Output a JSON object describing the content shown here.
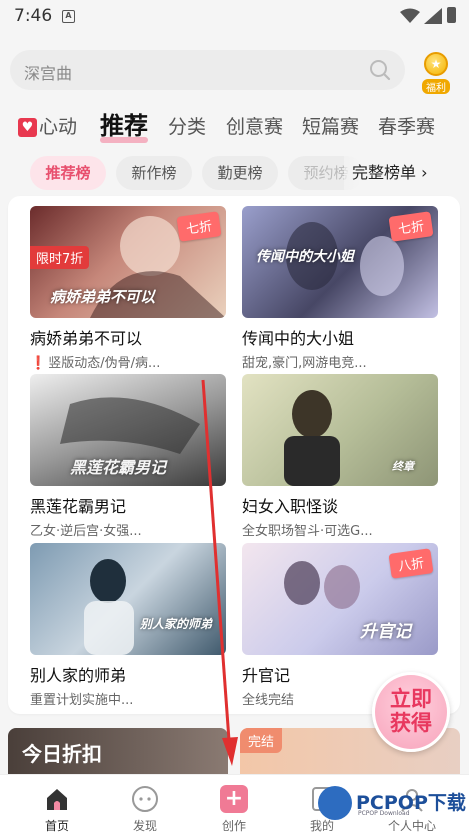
{
  "status_bar": {
    "time": "7:46",
    "notification_label": "A"
  },
  "search": {
    "placeholder": "深宫曲"
  },
  "welfare": {
    "label": "福利"
  },
  "category_tabs": [
    {
      "label": "心动"
    },
    {
      "label": "推荐"
    },
    {
      "label": "分类"
    },
    {
      "label": "创意赛"
    },
    {
      "label": "短篇赛"
    },
    {
      "label": "春季赛"
    }
  ],
  "rank_chips": [
    {
      "label": "推荐榜"
    },
    {
      "label": "新作榜"
    },
    {
      "label": "勤更榜"
    },
    {
      "label": "预约榜"
    }
  ],
  "full_rank_label": "完整榜单 ›",
  "books": [
    {
      "title": "病娇弟弟不可以",
      "tags": "竖版动态/伪骨/病...",
      "warning": "❗",
      "badge": "七折",
      "promo": "限时7折",
      "cover_text": "病娇弟弟不可以",
      "colors": [
        "#5a2a2a",
        "#b47a6a",
        "#e9c9b0"
      ]
    },
    {
      "title": "传闻中的大小姐",
      "tags": "甜宠,豪门,网游电竞...",
      "badge": "七折",
      "cover_text": "传闻中的大小姐",
      "colors": [
        "#8a8fb8",
        "#3d3d5c",
        "#b9b7d9"
      ]
    },
    {
      "title": "黑莲花霸男记",
      "tags": "乙女·逆后宫·女强...",
      "cover_text": "黑莲花霸男记",
      "colors": [
        "#c8c8c8",
        "#4a4a4a",
        "#eeeeee"
      ]
    },
    {
      "title": "妇女入职怪谈",
      "tags": "全女职场智斗·可选G...",
      "cover_text": "终章",
      "colors": [
        "#d8d8b0",
        "#3a3a3a",
        "#b9bfa0"
      ]
    },
    {
      "title": "别人家的师弟",
      "tags": "重置计划实施中...",
      "cover_text": "别人家的师弟",
      "colors": [
        "#6d8aa0",
        "#c9d3dc",
        "#3a5366"
      ]
    },
    {
      "title": "升官记",
      "tags": "全线完结",
      "badge": "八折",
      "cover_text": "升官记",
      "colors": [
        "#c6c6e8",
        "#f1e2ea",
        "#8d8dbf"
      ]
    }
  ],
  "today_sale_label": "今日折扣",
  "finished_label": "完结",
  "float_claim": {
    "line1": "立即",
    "line2": "获得"
  },
  "bottom_nav": [
    {
      "label": "首页"
    },
    {
      "label": "发现"
    },
    {
      "label": "创作"
    },
    {
      "label": "我的"
    },
    {
      "label": "个人中心"
    }
  ],
  "watermark": {
    "text": "PCPOP下载",
    "sub": "PCPOP Download"
  },
  "accent_color": "#e8506e"
}
